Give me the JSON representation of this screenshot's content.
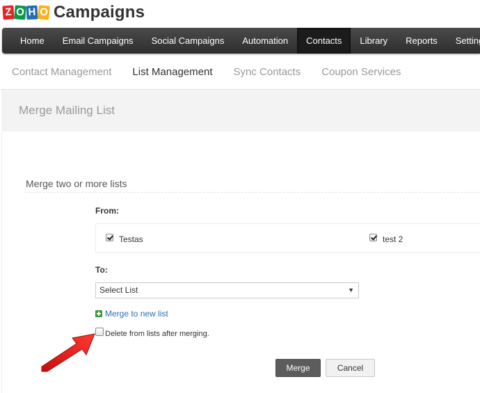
{
  "brand": {
    "logo_letters": [
      "Z",
      "O",
      "H",
      "O"
    ],
    "app_name": "Campaigns"
  },
  "nav": {
    "items": [
      {
        "label": "Home"
      },
      {
        "label": "Email Campaigns"
      },
      {
        "label": "Social Campaigns"
      },
      {
        "label": "Automation"
      },
      {
        "label": "Contacts",
        "active": true
      },
      {
        "label": "Library"
      },
      {
        "label": "Reports"
      },
      {
        "label": "Settings"
      }
    ]
  },
  "subnav": {
    "items": [
      {
        "label": "Contact Management"
      },
      {
        "label": "List Management",
        "active": true
      },
      {
        "label": "Sync Contacts"
      },
      {
        "label": "Coupon Services"
      }
    ]
  },
  "page": {
    "title": "Merge Mailing List",
    "section_title": "Merge two or more lists"
  },
  "form": {
    "from_label": "From:",
    "from_lists": [
      {
        "name": "Testas",
        "checked": true
      },
      {
        "name": "test 2",
        "checked": true
      }
    ],
    "to_label": "To:",
    "to_select_value": "Select List",
    "merge_new_link": "Merge to new list",
    "delete_option": {
      "label": "Delete from lists after merging.",
      "checked": false
    },
    "merge_button": "Merge",
    "cancel_button": "Cancel"
  },
  "colors": {
    "nav_bg": "#3a3a3a",
    "link": "#2a6fb3",
    "annotation_arrow": "#e8201c"
  }
}
